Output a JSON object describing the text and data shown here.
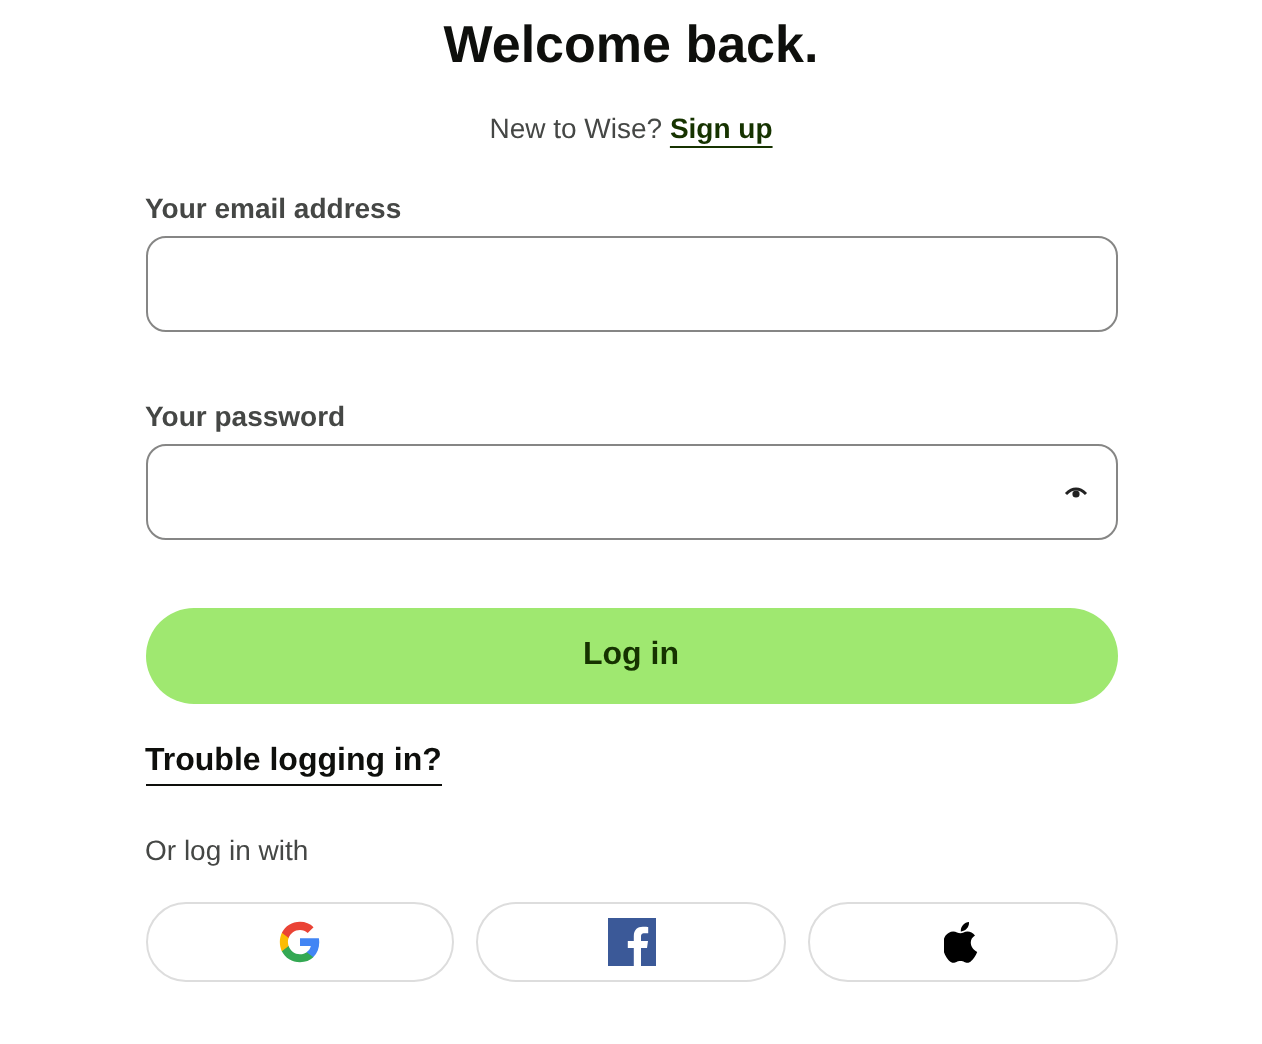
{
  "title": "Welcome back.",
  "signup": {
    "prompt": "New to Wise?",
    "link": "Sign up"
  },
  "fields": [
    {
      "label": "Your email address",
      "kind": "text"
    },
    {
      "label": "Your password",
      "kind": "password"
    }
  ],
  "login_button": "Log in",
  "trouble_link": "Trouble logging in?",
  "alt_prompt": "Or log in with",
  "social_buttons": [
    {
      "kind": "google"
    },
    {
      "kind": "facebook"
    },
    {
      "kind": "apple"
    }
  ]
}
